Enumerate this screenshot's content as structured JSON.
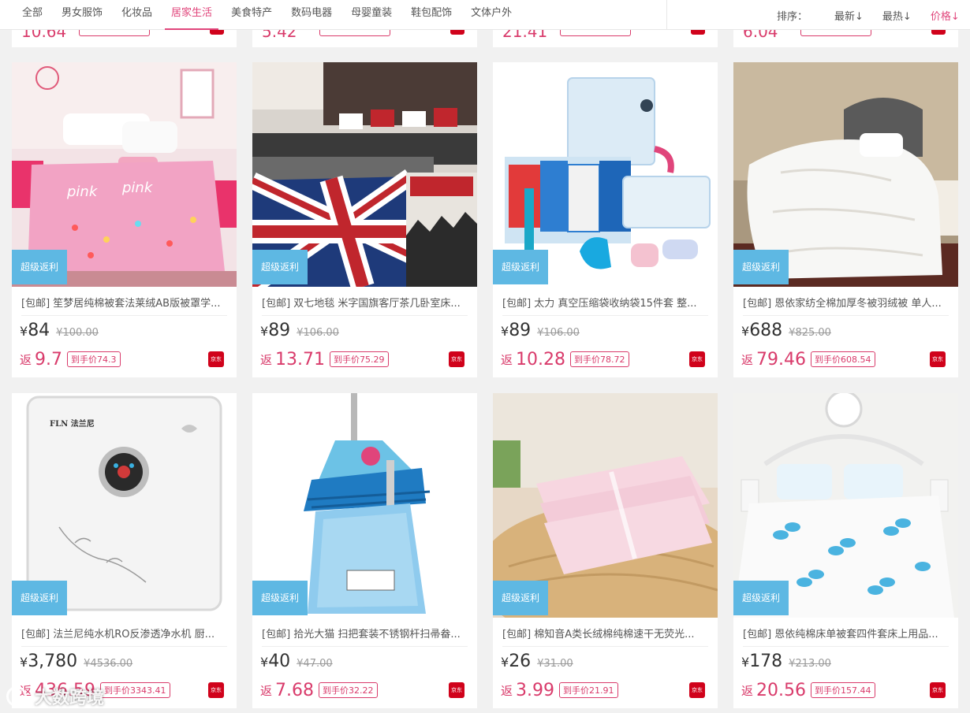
{
  "nav": {
    "tabs": [
      "全部",
      "男女服饰",
      "化妆品",
      "居家生活",
      "美食特产",
      "数码电器",
      "母婴童装",
      "鞋包配饰",
      "文体户外"
    ],
    "active_tab": 3,
    "sort_label": "排序：",
    "sort_options": [
      "最新↓",
      "最热↓",
      "价格↓"
    ]
  },
  "peek_cards": [
    {
      "rebate": "10.64"
    },
    {
      "rebate": "5.42"
    },
    {
      "rebate": "21.41"
    },
    {
      "rebate": "6.04"
    }
  ],
  "products": [
    {
      "badge": "超级返利",
      "title": "[包邮] 笙梦居纯棉被套法莱绒AB版被罩学...",
      "currency": "¥",
      "price": "84",
      "original": "¥100.00",
      "rebate_label": "返",
      "rebate": "9.7",
      "net_price": "到手价74.3",
      "store": "京东",
      "image": "pink-duvet"
    },
    {
      "badge": "超级返利",
      "title": "[包邮] 双七地毯 米字国旗客厅茶几卧室床...",
      "currency": "¥",
      "price": "89",
      "original": "¥106.00",
      "rebate_label": "返",
      "rebate": "13.71",
      "net_price": "到手价75.29",
      "store": "京东",
      "image": "union-jack-rug"
    },
    {
      "badge": "超级返利",
      "title": "[包邮] 太力 真空压缩袋收纳袋15件套 整...",
      "currency": "¥",
      "price": "89",
      "original": "¥106.00",
      "rebate_label": "返",
      "rebate": "10.28",
      "net_price": "到手价78.72",
      "store": "京东",
      "image": "vacuum-bags"
    },
    {
      "badge": "超级返利",
      "title": "[包邮] 恩依家纺全棉加厚冬被羽绒被 单人...",
      "currency": "¥",
      "price": "688",
      "original": "¥825.00",
      "rebate_label": "返",
      "rebate": "79.46",
      "net_price": "到手价608.54",
      "store": "京东",
      "image": "white-comforter"
    },
    {
      "badge": "超级返利",
      "title": "[包邮] 法兰尼纯水机RO反渗透净水机 厨...",
      "currency": "¥",
      "price": "3,780",
      "original": "¥4536.00",
      "rebate_label": "返",
      "rebate": "436.59",
      "net_price": "到手价3343.41",
      "store": "京东",
      "image": "water-purifier",
      "brand_text": "FLN 法兰尼"
    },
    {
      "badge": "超级返利",
      "title": "[包邮] 拾光大猫 扫把套装不锈钢杆扫帚畚...",
      "currency": "¥",
      "price": "40",
      "original": "¥47.00",
      "rebate_label": "返",
      "rebate": "7.68",
      "net_price": "到手价32.22",
      "store": "京东",
      "image": "broom-dustpan"
    },
    {
      "badge": "超级返利",
      "title": "[包邮] 棉知音A类长绒棉纯棉速干无荧光...",
      "currency": "¥",
      "price": "26",
      "original": "¥31.00",
      "rebate_label": "返",
      "rebate": "3.99",
      "net_price": "到手价21.91",
      "store": "京东",
      "image": "pink-towels"
    },
    {
      "badge": "超级返利",
      "title": "[包邮] 恩依纯棉床单被套四件套床上用品...",
      "currency": "¥",
      "price": "178",
      "original": "¥213.00",
      "rebate_label": "返",
      "rebate": "20.56",
      "net_price": "到手价157.44",
      "store": "京东",
      "image": "floral-bedding"
    }
  ],
  "watermark": "大数跨境",
  "colors": {
    "accent": "#e0457b",
    "price_red": "#d93b6b",
    "badge_blue": "#5eb8e3",
    "jd_red": "#d0021b"
  }
}
